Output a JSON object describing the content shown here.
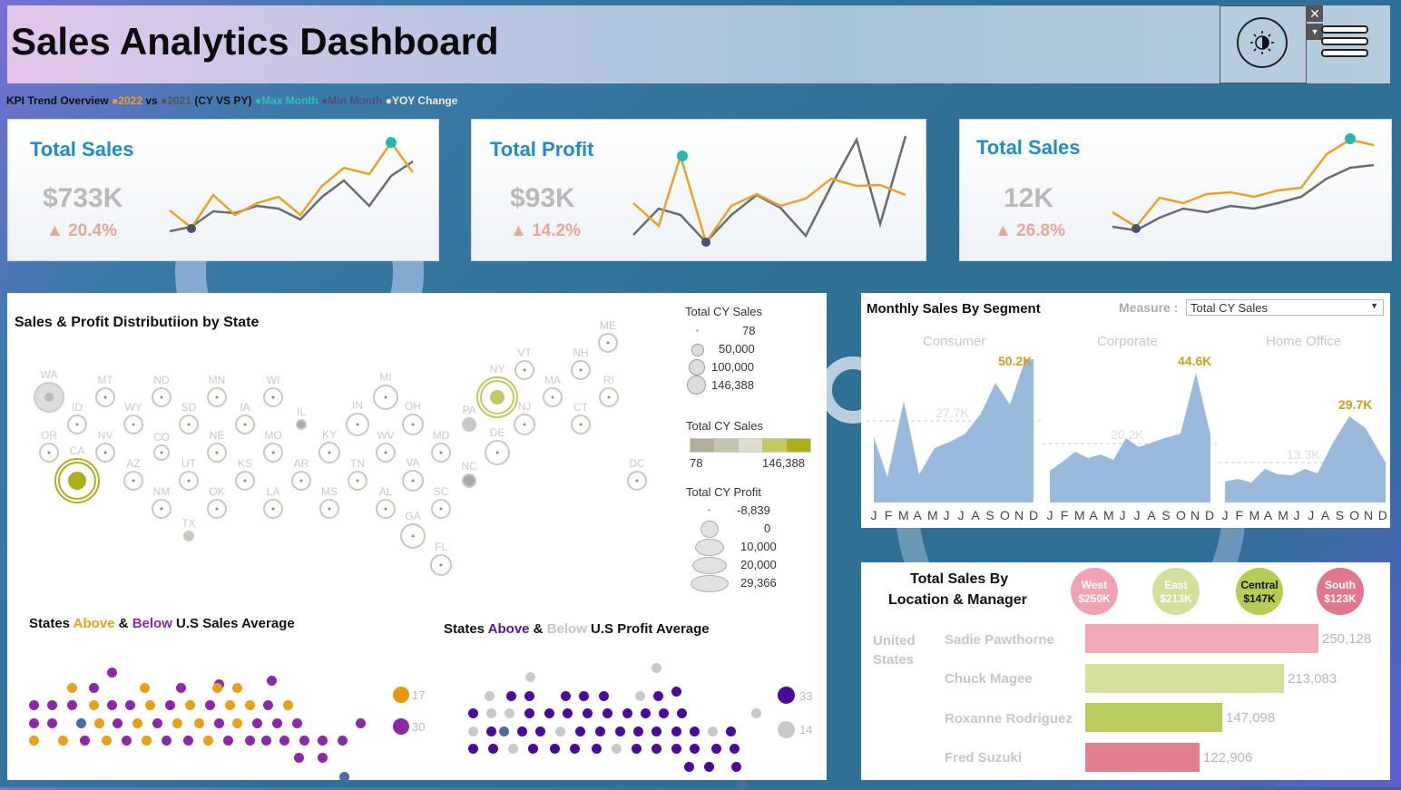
{
  "header": {
    "title": "Sales Analytics Dashboard"
  },
  "kpi_legend": {
    "prefix": "KPI Trend Overview",
    "y2022": "2022",
    "vs": "vs",
    "y2021": "2021",
    "cy_py": "(CY VS PY)",
    "max": "Max Month",
    "min": "Min Month",
    "yoy": "YOY Change"
  },
  "kpis": [
    {
      "title": "Total Sales",
      "value": "$733K",
      "change": "20.4%"
    },
    {
      "title": "Total Profit",
      "value": "$93K",
      "change": "14.2%"
    },
    {
      "title": "Total Sales",
      "value": "12K",
      "change": "26.8%"
    }
  ],
  "map": {
    "title": "Sales & Profit Distributiion by State",
    "states": [
      "ME",
      "VT",
      "NH",
      "WA",
      "MT",
      "ND",
      "MN",
      "WI",
      "MI",
      "NY",
      "MA",
      "RI",
      "ID",
      "WY",
      "SD",
      "IA",
      "IL",
      "IN",
      "OH",
      "PA",
      "NJ",
      "CT",
      "OR",
      "NV",
      "CO",
      "NE",
      "MO",
      "KY",
      "WV",
      "MD",
      "DE",
      "CA",
      "AZ",
      "UT",
      "KS",
      "AR",
      "TN",
      "VA",
      "NC",
      "DC",
      "NM",
      "OK",
      "LA",
      "MS",
      "AL",
      "SC",
      "TX",
      "GA",
      "FL"
    ],
    "legend_size_title": "Total CY Sales",
    "legend_size_values": [
      "78",
      "50,000",
      "100,000",
      "146,388"
    ],
    "legend_color_title": "Total CY Sales",
    "legend_color_min": "78",
    "legend_color_max": "146,388",
    "legend_profit_title": "Total CY Profit",
    "legend_profit_values": [
      "-8,839",
      "0",
      "10,000",
      "20,000",
      "29,366"
    ]
  },
  "segment": {
    "title": "Monthly Sales By Segment",
    "measure_label": "Measure :",
    "measure_value": "Total CY Sales",
    "panels": [
      {
        "name": "Consumer",
        "max_label": "50.2K",
        "avg_label": "27.7K"
      },
      {
        "name": "Corporate",
        "max_label": "44.6K",
        "avg_label": "20.2K"
      },
      {
        "name": "Home Office",
        "max_label": "29.7K",
        "avg_label": "13.3K"
      }
    ],
    "months": [
      "J",
      "F",
      "M",
      "A",
      "M",
      "J",
      "J",
      "A",
      "S",
      "O",
      "N",
      "D"
    ]
  },
  "sales_avg": {
    "title_states": "States",
    "title_above": "Above",
    "title_amp": "&",
    "title_below": "Below",
    "title_rest": "U.S Sales Average",
    "count_above": "17",
    "count_below": "30"
  },
  "profit_avg": {
    "title_states": "States",
    "title_above": "Above",
    "title_amp": "&",
    "title_below": "Below",
    "title_rest": "U.S Profit Average",
    "count_above": "33",
    "count_below": "14"
  },
  "location": {
    "title_line1": "Total Sales By",
    "title_line2": "Location & Manager",
    "country_line1": "United",
    "country_line2": "States",
    "regions": [
      {
        "name": "West",
        "value": "$250K",
        "color": "#f2a3b3"
      },
      {
        "name": "East",
        "value": "$213K",
        "color": "#d3df9a"
      },
      {
        "name": "Central",
        "value": "$147K",
        "color": "#b5cc55"
      },
      {
        "name": "South",
        "value": "$123K",
        "color": "#e0778a"
      }
    ],
    "managers": [
      {
        "name": "Sadie Pawthorne",
        "value": "250,128"
      },
      {
        "name": "Chuck Magee",
        "value": "213,083"
      },
      {
        "name": "Roxanne Rodriguez",
        "value": "147,098"
      },
      {
        "name": "Fred Suzuki",
        "value": "122,906"
      }
    ]
  }
}
